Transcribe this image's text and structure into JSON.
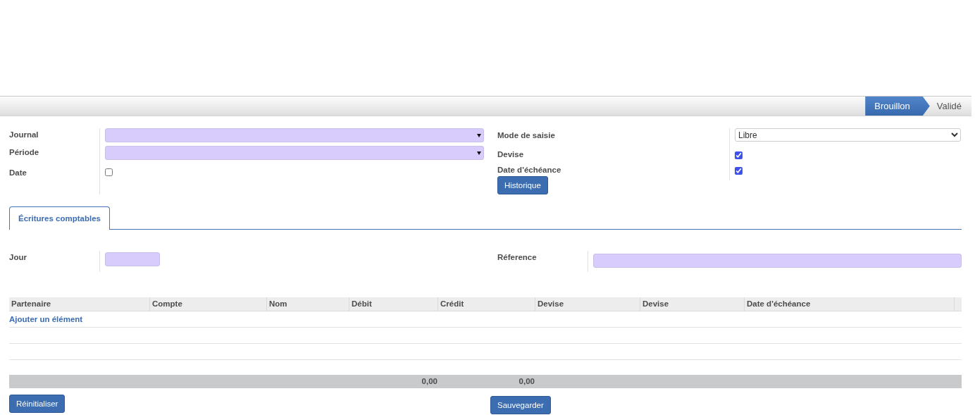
{
  "status_bar": {
    "stages": [
      {
        "label": "Brouillon",
        "selected": true
      },
      {
        "label": "Validé",
        "selected": false
      }
    ]
  },
  "header_left": [
    {
      "label": "Journal",
      "kind": "dropdown"
    },
    {
      "label": "Période",
      "kind": "dropdown"
    },
    {
      "label": "Date",
      "kind": "checkbox",
      "checked": false
    }
  ],
  "header_right": [
    {
      "label": "Mode de saisie",
      "kind": "select",
      "value": "Libre"
    },
    {
      "label": "Devise",
      "kind": "checkbox",
      "checked": true
    },
    {
      "label": "Date d'échéance",
      "kind": "checkbox",
      "checked": true
    }
  ],
  "history_button": "Historique",
  "tabs": [
    {
      "label": "Écritures comptables",
      "selected": true
    }
  ],
  "line_fields": [
    {
      "label": "Jour",
      "kind": "short"
    },
    {
      "label": "Réference",
      "kind": "wide"
    }
  ],
  "table": {
    "columns": [
      "Partenaire",
      "Compte",
      "Nom",
      "Débit",
      "Crédit",
      "Devise",
      "Devise",
      "Date d'échéance"
    ],
    "add_link": "Ajouter un élément",
    "totals": {
      "debit": "0,00",
      "credit": "0,00"
    }
  },
  "buttons": {
    "reset": "Réinitialiser",
    "save": "Sauvegarder"
  }
}
